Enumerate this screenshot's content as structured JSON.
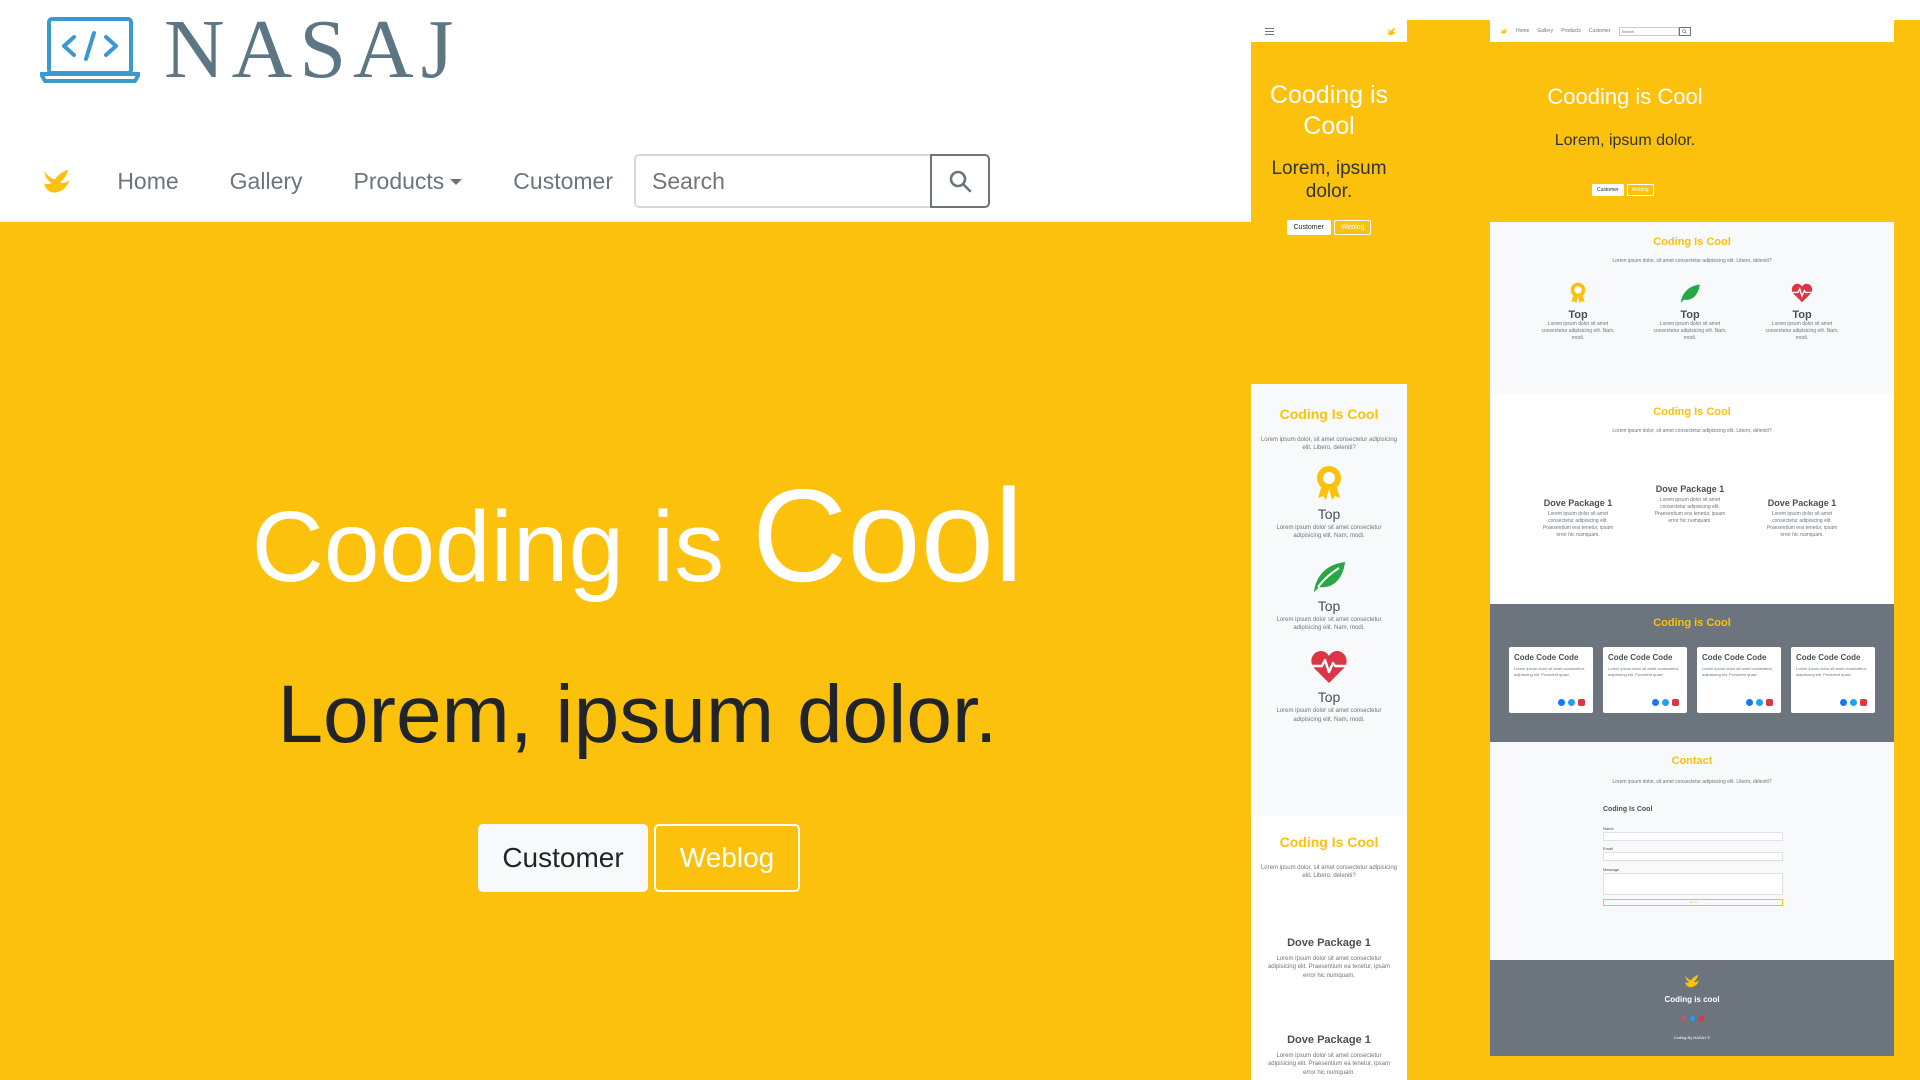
{
  "brand": {
    "name": "NASAJ"
  },
  "nav": {
    "items": [
      "Home",
      "Gallery",
      "Products",
      "Customer"
    ],
    "search_placeholder": "Search"
  },
  "hero": {
    "title_start": "Cooding is ",
    "title_end": "Cool",
    "subtitle": "Lorem, ipsum dolor.",
    "button_primary": "Customer",
    "button_secondary": "Weblog"
  },
  "mobile": {
    "hero_title": "Cooding is Cool",
    "hero_subtitle": "Lorem, ipsum dolor.",
    "btn_customer": "Customer",
    "btn_weblog": "Weblog",
    "features_title": "Coding Is Cool",
    "features_text": "Lorem ipsum dolor, sit amet consectetur adipisicing elit. Libero, deleniti?",
    "feature_label": "Top",
    "feature_text": "Lorem ipsum dolor sit amet consectetur adipisicing elit. Nam, modi.",
    "packages_title": "Coding Is Cool",
    "packages_text": "Lorem ipsum dolor, sit amet consectetur adipisicing elit. Libero, deleniti?",
    "package_title": "Dove Package 1",
    "package_text": "Lorem ipsum dolor sit amet consectetur adipisicing elit. Praesentium ea tenetur, ipsam error hic numquam."
  },
  "desktop": {
    "nav_items": [
      "Home",
      "Gallery",
      "Products",
      "Customer"
    ],
    "search_placeholder": "Search",
    "hero_title": "Cooding is Cool",
    "hero_subtitle": "Lorem, ipsum dolor.",
    "btn_customer": "Customer",
    "btn_weblog": "Weblog",
    "features_title": "Coding Is Cool",
    "features_text": "Lorem ipsum dolor, sit amet consectetur adipisicing elit. Libero, deleniti?",
    "feature_label": "Top",
    "feature_text": "Lorem ipsum dolor sit amet consectetur adipisicing elit. Nam, modi.",
    "packages_title": "Coding Is Cool",
    "packages_text": "Lorem ipsum dolor, sit amet consectetur adipisicing elit. Libero, deleniti?",
    "package_title": "Dove Package 1",
    "package_text": "Lorem ipsum dolor sit amet consectetur adipisicing elit. Praesentium eos tenetur, ipsam error hic numquam.",
    "team_title": "Coding is Cool",
    "card_title": "Code Code Code",
    "card_text": "Lorem ipsum dolor sit amet consectetur, adipisicing elit. Provident quas!",
    "contact_title": "Contact",
    "contact_text": "Lorem ipsum dolor, sit amet consectetur adipisicing elit. Libero, deleniti?",
    "form_title": "Coding Is Cool",
    "form_name": "Name",
    "form_email": "Email",
    "form_message": "Message",
    "form_submit": "Send",
    "footer_title": "Coding is cool",
    "footer_copy": "Coding By NASAJ ©"
  },
  "colors": {
    "accent": "#fcc10c",
    "muted": "#6c757d",
    "light": "#f8f9fa",
    "logo": "#3a9ad0",
    "green": "#28a745",
    "red": "#dc3545"
  }
}
